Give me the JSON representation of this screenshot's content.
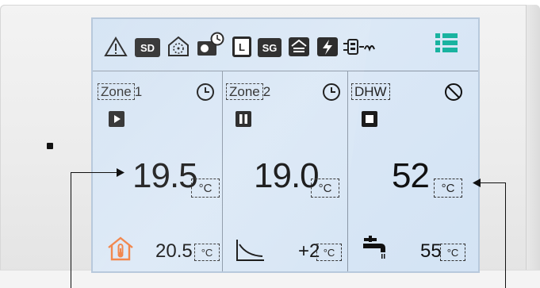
{
  "status_icons": {
    "warning": "warning-icon",
    "sd": "SD",
    "defrost": "defrost-icon",
    "schedule_unit": "schedule-unit-icon",
    "l_mode": "L",
    "sg": "SG",
    "house_flow": "house-flow-icon",
    "power": "power-icon",
    "heat_exchange": "heat-exchange-icon",
    "menu": "menu-icon"
  },
  "colors": {
    "menu_accent": "#19b3a0",
    "house_accent": "#f07a3a"
  },
  "zones": [
    {
      "label": "Zone",
      "number": "1",
      "state_icon": "play-icon",
      "mode_icon": "clock-icon",
      "temperature": "19.5",
      "unit": "°C",
      "footer_icon": "house-thermometer-icon",
      "footer_value": "20.5",
      "footer_unit": "°C"
    },
    {
      "label": "Zone",
      "number": "2",
      "state_icon": "pause-icon",
      "mode_icon": "clock-icon",
      "temperature": "19.0",
      "unit": "°C",
      "footer_icon": "heating-curve-icon",
      "footer_value": "+2",
      "footer_unit": "°C"
    },
    {
      "label": "DHW",
      "number": "",
      "state_icon": "stop-icon",
      "mode_icon": "disabled-icon",
      "temperature": "52",
      "unit": "°C",
      "footer_icon": "tap-icon",
      "footer_value": "55",
      "footer_unit": "°C"
    }
  ]
}
